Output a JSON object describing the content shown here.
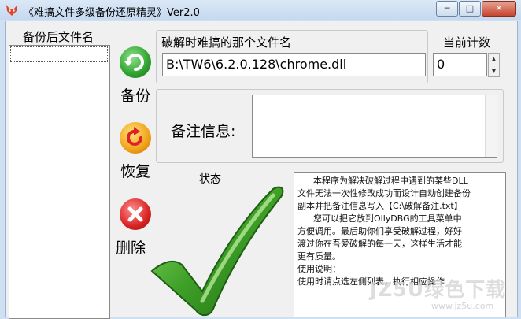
{
  "window": {
    "title": "《难搞文件多级备份还原精灵》Ver2.0",
    "controls": {
      "minimize": "─",
      "maximize": "□",
      "close": "✕"
    }
  },
  "sidebar": {
    "list_header": "备份后文件名"
  },
  "file": {
    "label": "破解时难搞的那个文件名",
    "value": "B:\\TW6\\6.2.0.128\\chrome.dll"
  },
  "counter": {
    "label": "当前计数",
    "value": "0"
  },
  "notes": {
    "label": "备注信息:",
    "value": ""
  },
  "actions": {
    "backup": "备份",
    "restore": "恢复",
    "delete": "删除"
  },
  "status": {
    "label": "状态"
  },
  "info": {
    "lines": [
      "本程序为解决破解过程中遇到的某些DLL",
      "文件无法一次性修改成功而设计自动创建备份",
      "副本并把备注信息写入【C:\\破解备注.txt】",
      "您可以把它放到OllyDBG的工具菜单中",
      "方便调用。最后助你们享受破解过程，好好",
      "渡过你在吾爱破解的每一天，这样生活才能",
      "更有质量。",
      "",
      "使用说明：",
      "使用时请点选左侧列表，执行相应操作"
    ]
  },
  "watermark": {
    "brand": "JZ5U绿色下载",
    "url": "www.jz5u.com"
  },
  "colors": {
    "titlebar": "#c4d8ef",
    "check_green": "#3ea028",
    "backup_green": "#2fa12f",
    "restore_orange": "#f0a21a",
    "delete_red": "#d92323"
  }
}
